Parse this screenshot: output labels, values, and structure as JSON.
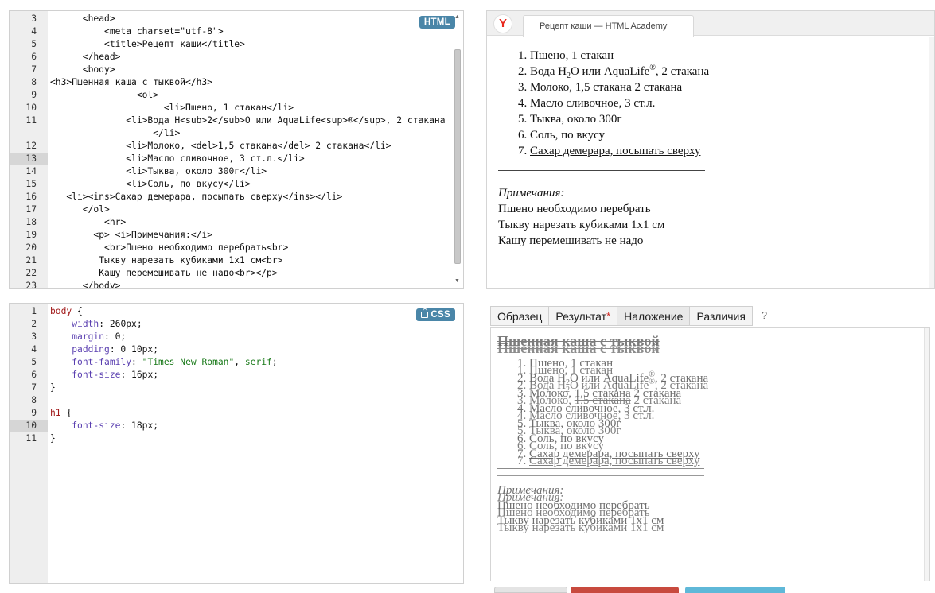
{
  "html_editor": {
    "badge": "HTML",
    "lines": [
      {
        "n": "3",
        "text": "      <head>"
      },
      {
        "n": "4",
        "text": "          <meta charset=\"utf-8\">"
      },
      {
        "n": "5",
        "text": "          <title>Рецепт каши</title>"
      },
      {
        "n": "6",
        "text": "      </head>"
      },
      {
        "n": "7",
        "text": "      <body>"
      },
      {
        "n": "8",
        "text": "<h3>Пшенная каша с тыквой</h3>"
      },
      {
        "n": "9",
        "text": "                <ol>"
      },
      {
        "n": "10",
        "text": "                     <li>Пшено, 1 стакан</li>"
      },
      {
        "n": "11",
        "text": "              <li>Вода H<sub>2</sub>O или AquaLife<sup>®</sup>, 2 стакана\n                   </li>",
        "tall": true
      },
      {
        "n": "12",
        "text": "              <li>Молоко, <del>1,5 стакана</del> 2 стакана</li>"
      },
      {
        "n": "13",
        "text": "              <li>Масло сливочное, 3 ст.л.</li>",
        "active": true
      },
      {
        "n": "14",
        "text": "              <li>Тыква, около 300г</li>"
      },
      {
        "n": "15",
        "text": "              <li>Соль, по вкусу</li>"
      },
      {
        "n": "16",
        "text": "   <li><ins>Сахар демерара, посыпать сверху</ins></li>"
      },
      {
        "n": "17",
        "text": "      </ol>"
      },
      {
        "n": "18",
        "text": "          <hr>"
      },
      {
        "n": "19",
        "text": "        <p> <i>Примечания:</i>"
      },
      {
        "n": "20",
        "text": "          <br>Пшено необходимо перебрать<br>"
      },
      {
        "n": "21",
        "text": "         Тыкву нарезать кубиками 1х1 см<br>"
      },
      {
        "n": "22",
        "text": "         Кашу перемешивать не надо<br></p>"
      },
      {
        "n": "23",
        "text": "      </body>"
      }
    ]
  },
  "css_editor": {
    "badge": "CSS",
    "lines": [
      {
        "n": "1",
        "parts": [
          {
            "t": "body",
            "c": "c-sel"
          },
          {
            "t": " {"
          }
        ]
      },
      {
        "n": "2",
        "parts": [
          {
            "t": "    "
          },
          {
            "t": "width",
            "c": "c-prop"
          },
          {
            "t": ": 260px;"
          }
        ]
      },
      {
        "n": "3",
        "parts": [
          {
            "t": "    "
          },
          {
            "t": "margin",
            "c": "c-prop"
          },
          {
            "t": ": 0;"
          }
        ]
      },
      {
        "n": "4",
        "parts": [
          {
            "t": "    "
          },
          {
            "t": "padding",
            "c": "c-prop"
          },
          {
            "t": ": 0 10px;"
          }
        ]
      },
      {
        "n": "5",
        "parts": [
          {
            "t": "    "
          },
          {
            "t": "font-family",
            "c": "c-prop"
          },
          {
            "t": ": "
          },
          {
            "t": "\"Times New Roman\"",
            "c": "c-str"
          },
          {
            "t": ", "
          },
          {
            "t": "serif",
            "c": "c-str"
          },
          {
            "t": ";"
          }
        ]
      },
      {
        "n": "6",
        "parts": [
          {
            "t": "    "
          },
          {
            "t": "font-size",
            "c": "c-prop"
          },
          {
            "t": ": 16px;"
          }
        ]
      },
      {
        "n": "7",
        "parts": [
          {
            "t": "}"
          }
        ]
      },
      {
        "n": "8",
        "parts": [
          {
            "t": ""
          }
        ]
      },
      {
        "n": "9",
        "parts": [
          {
            "t": "h1",
            "c": "c-sel"
          },
          {
            "t": " {"
          }
        ]
      },
      {
        "n": "10",
        "parts": [
          {
            "t": "    "
          },
          {
            "t": "font-size",
            "c": "c-prop"
          },
          {
            "t": ": 18px;"
          }
        ],
        "active": true
      },
      {
        "n": "11",
        "parts": [
          {
            "t": "}"
          }
        ]
      }
    ]
  },
  "browser": {
    "logo_letter": "Y",
    "tab_title": "Рецепт каши — HTML Academy",
    "list": {
      "item1": "Пшено, 1 стакан",
      "item2_pre": "Вода H",
      "item2_sub": "2",
      "item2_mid": "O или AquaLife",
      "item2_sup": "®",
      "item2_post": ", 2 стакана",
      "item3_pre": "Молоко, ",
      "item3_del": "1,5 стакана",
      "item3_post": " 2 стакана",
      "item4": "Масло сливочное, 3 ст.л.",
      "item5": "Тыква, около 300г",
      "item6": "Соль, по вкусу",
      "item7": "Сахар демерара, посыпать сверху"
    },
    "notes_title": "Примечания:",
    "note1": "Пшено необходимо перебрать",
    "note2": "Тыкву нарезать кубиками 1х1 см",
    "note3": "Кашу перемешивать не надо"
  },
  "compare": {
    "tabs": {
      "sample": "Образец",
      "result": "Результат",
      "result_star": "*",
      "overlay": "Наложение",
      "diff": "Различия"
    },
    "help": "?",
    "heading": "Пшенная каша с тыквой",
    "list": {
      "item1": "Пшено, 1 стакан",
      "item2_pre": "Вода H",
      "item2_sub": "2",
      "item2_mid": "O или AquaLife",
      "item2_sup": "®",
      "item2_post": ", 2 стакана",
      "item3_pre": "Молоко, ",
      "item3_del": "1,5 стакана",
      "item3_post": " 2 стакана",
      "item4": "Масло сливочное, 3 ст.л.",
      "item5": "Тыква, около 300г",
      "item6": "Соль, по вкусу",
      "item7": "Сахар демерара, посыпать сверху"
    },
    "notes_title": "Примечания:",
    "note1": "Пшено необходимо перебрать",
    "note2": "Тыкву нарезать кубиками 1х1 см"
  },
  "colors": {
    "badge": "#4a86a8",
    "property": "#5a3fb0",
    "selector": "#a11a1a",
    "string": "#1a7a1a",
    "star": "#d0201a"
  }
}
